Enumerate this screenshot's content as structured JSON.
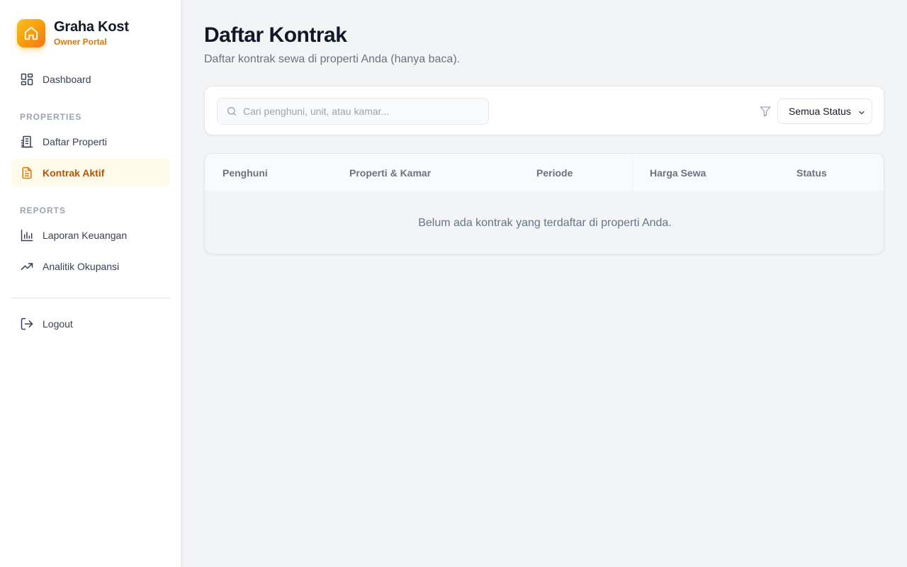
{
  "brand": {
    "title": "Graha Kost",
    "subtitle": "Owner Portal"
  },
  "sidebar": {
    "dashboard": "Dashboard",
    "section_properties": "PROPERTIES",
    "daftar_properti": "Daftar Properti",
    "kontrak_aktif": "Kontrak Aktif",
    "section_reports": "REPORTS",
    "laporan_keuangan": "Laporan Keuangan",
    "analitik_okupansi": "Analitik Okupansi",
    "logout": "Logout"
  },
  "page": {
    "title": "Daftar Kontrak",
    "subtitle": "Daftar kontrak sewa di properti Anda (hanya baca)."
  },
  "filters": {
    "search_placeholder": "Cari penghuni, unit, atau kamar...",
    "search_value": "",
    "status_selected": "Semua Status"
  },
  "table": {
    "columns": [
      "Penghuni",
      "Properti & Kamar",
      "Periode",
      "Harga Sewa",
      "Status"
    ],
    "rows": [],
    "empty_message": "Belum ada kontrak yang terdaftar di properti Anda."
  },
  "colors": {
    "accent": "#f59e0b",
    "active_bg": "#fffbeb",
    "active_text": "#b45309"
  }
}
